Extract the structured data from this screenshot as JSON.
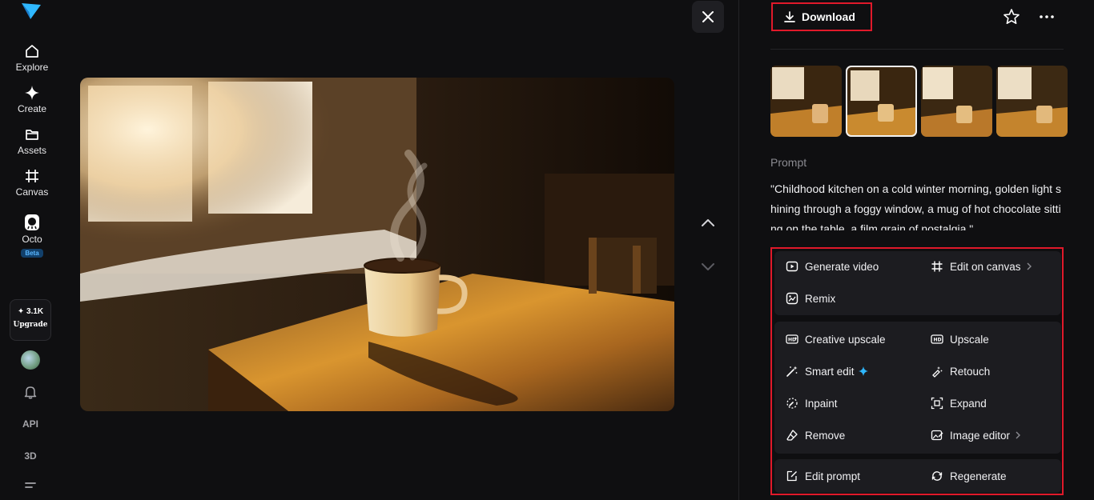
{
  "sidebar": {
    "items": [
      {
        "label": "Explore",
        "icon": "home-icon"
      },
      {
        "label": "Create",
        "icon": "sparkle-icon"
      },
      {
        "label": "Assets",
        "icon": "folder-icon"
      },
      {
        "label": "Canvas",
        "icon": "canvas-icon"
      },
      {
        "label": "Octo",
        "icon": "octo-icon",
        "badge": "Beta"
      }
    ],
    "credits": "✦ 3.1K",
    "upgrade_label": "Upgrade",
    "api_label": "API",
    "three_d_label": "3D"
  },
  "toolbar": {
    "download_label": "Download"
  },
  "prompt": {
    "label": "Prompt",
    "text": "\"Childhood kitchen on a cold winter morning, golden light shining through a foggy window, a mug of hot chocolate sitting on the table, a film grain of nostalgia.\""
  },
  "actions": {
    "group1": [
      {
        "label": "Generate video",
        "icon": "video-play-icon"
      },
      {
        "label": "Edit on canvas",
        "icon": "canvas-icon",
        "chevron": true
      },
      {
        "label": "Remix",
        "icon": "remix-icon"
      }
    ],
    "group2": [
      {
        "label": "Creative upscale",
        "icon": "hd-plus-icon"
      },
      {
        "label": "Upscale",
        "icon": "hd-icon"
      },
      {
        "label": "Smart edit",
        "icon": "magic-wand-icon",
        "spark": true
      },
      {
        "label": "Retouch",
        "icon": "retouch-icon"
      },
      {
        "label": "Inpaint",
        "icon": "inpaint-icon"
      },
      {
        "label": "Expand",
        "icon": "expand-icon"
      },
      {
        "label": "Remove",
        "icon": "eraser-icon"
      },
      {
        "label": "Image editor",
        "icon": "image-editor-icon",
        "chevron": true
      }
    ],
    "group3": [
      {
        "label": "Edit prompt",
        "icon": "edit-prompt-icon"
      },
      {
        "label": "Regenerate",
        "icon": "regenerate-icon"
      }
    ]
  },
  "colors": {
    "background": "#0f0f11",
    "highlight_border": "#e0192a",
    "accent": "#2fb8ff",
    "panel_group": "#1c1c20"
  }
}
